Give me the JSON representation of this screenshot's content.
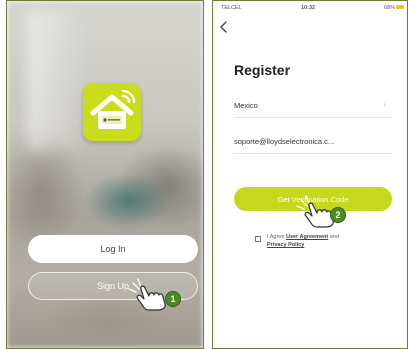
{
  "login_screen": {
    "login_label": "Log In",
    "signup_label": "Sign Up",
    "step_number": "1"
  },
  "register_screen": {
    "status": {
      "carrier": "TELCEL",
      "time": "10:32",
      "battery": "68%"
    },
    "title": "Register",
    "country": "Mexico",
    "email": "soporte@lloydselectronica.c...",
    "verify_label": "Get Verification Code",
    "agree_prefix": "I Agree",
    "user_agreement": "User Agreement",
    "and": "and",
    "privacy_policy": "Privacy Policy",
    "step_number": "2"
  },
  "colors": {
    "brand_lime": "#c5d81e",
    "badge_green": "#4e8a24"
  },
  "icons": {
    "logo": "smart-home-logo-icon",
    "back": "chevron-left-icon",
    "pointer": "hand-pointer-icon"
  }
}
